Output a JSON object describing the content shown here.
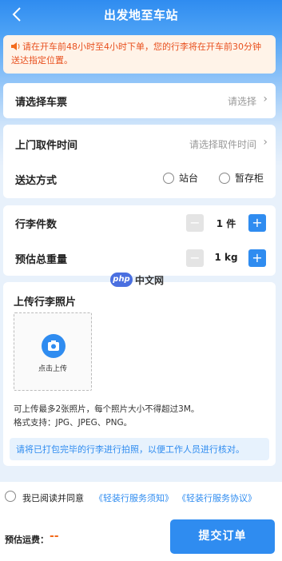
{
  "header": {
    "back_icon": "chevron-left-icon",
    "title": "出发地至车站"
  },
  "notice": {
    "icon": "speaker-icon",
    "text": "请在开车前48小时至4小时下单，您的行李将在开车前30分钟送达指定位置。"
  },
  "ticket": {
    "label": "请选择车票",
    "placeholder": "请选择"
  },
  "pickup": {
    "time_label": "上门取件时间",
    "time_placeholder": "请选择取件时间",
    "delivery_label": "送达方式",
    "options": [
      "站台",
      "暂存柜"
    ]
  },
  "luggage": {
    "count_label": "行李件数",
    "count_value": "1 件",
    "weight_label": "预估总重量",
    "weight_value": "1 kg",
    "minus": "−",
    "plus": "+"
  },
  "upload": {
    "title": "上传行李照片",
    "button_label": "点击上传",
    "hint1": "可上传最多2张照片，每个照片大小不得超过3M。",
    "hint2": "格式支持：JPG、JPEG、PNG。",
    "tip": "请将已打包完毕的行李进行拍照，以便工作人员进行核对。"
  },
  "agreement": {
    "prefix": "我已阅读并同意",
    "link1": "《轻装行服务须知》",
    "link2": "《轻装行服务协议》"
  },
  "footer": {
    "fee_label": "预估运费：",
    "fee_value": "--",
    "submit_label": "提交订单"
  },
  "watermark": {
    "badge": "php",
    "text": "中文网"
  },
  "colors": {
    "primary": "#2f8cf0",
    "warning": "#e8501e",
    "fee": "#f36b1c"
  }
}
